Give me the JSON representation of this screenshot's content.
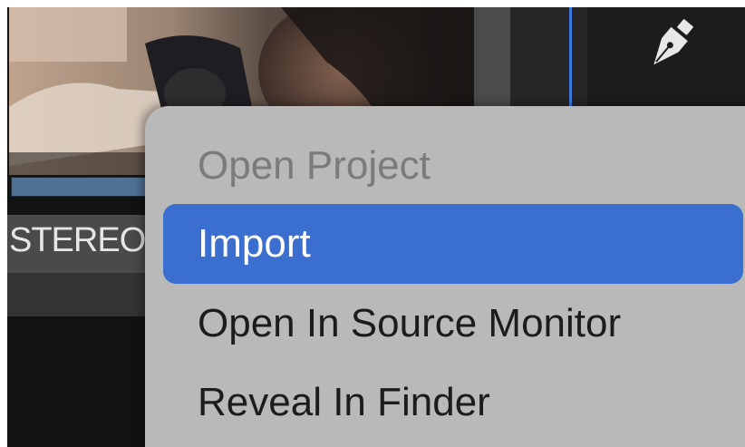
{
  "clip": {
    "channel_label": "STEREO"
  },
  "tools": {
    "active_tool_icon": "pen-tool-icon"
  },
  "context_menu": {
    "items": [
      {
        "label": "Open Project",
        "state": "disabled"
      },
      {
        "label": "Import",
        "state": "selected"
      },
      {
        "label": "Open In Source Monitor",
        "state": "enabled"
      },
      {
        "label": "Reveal In Finder",
        "state": "enabled"
      }
    ]
  },
  "colors": {
    "selection": "#3a6fd0",
    "menu_background": "#b9b9b9",
    "playhead": "#3b7be0",
    "clip_bar": "#4f7294"
  }
}
